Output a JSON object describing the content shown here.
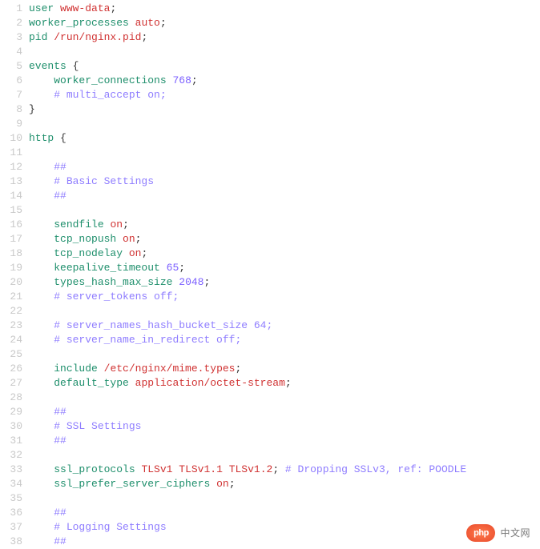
{
  "watermark": {
    "logo": "php",
    "text": "中文网"
  },
  "lines": [
    {
      "n": 1,
      "tokens": [
        [
          "kw",
          "user"
        ],
        [
          "txt",
          " "
        ],
        [
          "val",
          "www-data"
        ],
        [
          "txt",
          ";"
        ]
      ]
    },
    {
      "n": 2,
      "tokens": [
        [
          "kw",
          "worker_processes"
        ],
        [
          "txt",
          " "
        ],
        [
          "val",
          "auto"
        ],
        [
          "txt",
          ";"
        ]
      ]
    },
    {
      "n": 3,
      "tokens": [
        [
          "kw",
          "pid"
        ],
        [
          "txt",
          " "
        ],
        [
          "val",
          "/run/nginx.pid"
        ],
        [
          "txt",
          ";"
        ]
      ]
    },
    {
      "n": 4,
      "tokens": []
    },
    {
      "n": 5,
      "tokens": [
        [
          "kw",
          "events"
        ],
        [
          "txt",
          " "
        ],
        [
          "brace",
          "{"
        ]
      ]
    },
    {
      "n": 6,
      "tokens": [
        [
          "txt",
          "    "
        ],
        [
          "kw",
          "worker_connections"
        ],
        [
          "txt",
          " "
        ],
        [
          "num",
          "768"
        ],
        [
          "txt",
          ";"
        ]
      ]
    },
    {
      "n": 7,
      "tokens": [
        [
          "txt",
          "    "
        ],
        [
          "cmt",
          "# multi_accept on;"
        ]
      ]
    },
    {
      "n": 8,
      "tokens": [
        [
          "brace",
          "}"
        ]
      ]
    },
    {
      "n": 9,
      "tokens": []
    },
    {
      "n": 10,
      "tokens": [
        [
          "kw",
          "http"
        ],
        [
          "txt",
          " "
        ],
        [
          "brace",
          "{"
        ]
      ]
    },
    {
      "n": 11,
      "tokens": []
    },
    {
      "n": 12,
      "tokens": [
        [
          "txt",
          "    "
        ],
        [
          "cmt",
          "##"
        ]
      ]
    },
    {
      "n": 13,
      "tokens": [
        [
          "txt",
          "    "
        ],
        [
          "cmt",
          "# Basic Settings"
        ]
      ]
    },
    {
      "n": 14,
      "tokens": [
        [
          "txt",
          "    "
        ],
        [
          "cmt",
          "##"
        ]
      ]
    },
    {
      "n": 15,
      "tokens": []
    },
    {
      "n": 16,
      "tokens": [
        [
          "txt",
          "    "
        ],
        [
          "kw",
          "sendfile"
        ],
        [
          "txt",
          " "
        ],
        [
          "val",
          "on"
        ],
        [
          "txt",
          ";"
        ]
      ]
    },
    {
      "n": 17,
      "tokens": [
        [
          "txt",
          "    "
        ],
        [
          "kw",
          "tcp_nopush"
        ],
        [
          "txt",
          " "
        ],
        [
          "val",
          "on"
        ],
        [
          "txt",
          ";"
        ]
      ]
    },
    {
      "n": 18,
      "tokens": [
        [
          "txt",
          "    "
        ],
        [
          "kw",
          "tcp_nodelay"
        ],
        [
          "txt",
          " "
        ],
        [
          "val",
          "on"
        ],
        [
          "txt",
          ";"
        ]
      ]
    },
    {
      "n": 19,
      "tokens": [
        [
          "txt",
          "    "
        ],
        [
          "kw",
          "keepalive_timeout"
        ],
        [
          "txt",
          " "
        ],
        [
          "num",
          "65"
        ],
        [
          "txt",
          ";"
        ]
      ]
    },
    {
      "n": 20,
      "tokens": [
        [
          "txt",
          "    "
        ],
        [
          "kw",
          "types_hash_max_size"
        ],
        [
          "txt",
          " "
        ],
        [
          "num",
          "2048"
        ],
        [
          "txt",
          ";"
        ]
      ]
    },
    {
      "n": 21,
      "tokens": [
        [
          "txt",
          "    "
        ],
        [
          "cmt",
          "# server_tokens off;"
        ]
      ]
    },
    {
      "n": 22,
      "tokens": []
    },
    {
      "n": 23,
      "tokens": [
        [
          "txt",
          "    "
        ],
        [
          "cmt",
          "# server_names_hash_bucket_size 64;"
        ]
      ]
    },
    {
      "n": 24,
      "tokens": [
        [
          "txt",
          "    "
        ],
        [
          "cmt",
          "# server_name_in_redirect off;"
        ]
      ]
    },
    {
      "n": 25,
      "tokens": []
    },
    {
      "n": 26,
      "tokens": [
        [
          "txt",
          "    "
        ],
        [
          "kw",
          "include"
        ],
        [
          "txt",
          " "
        ],
        [
          "val",
          "/etc/nginx/mime.types"
        ],
        [
          "txt",
          ";"
        ]
      ]
    },
    {
      "n": 27,
      "tokens": [
        [
          "txt",
          "    "
        ],
        [
          "kw",
          "default_type"
        ],
        [
          "txt",
          " "
        ],
        [
          "val",
          "application/octet-stream"
        ],
        [
          "txt",
          ";"
        ]
      ]
    },
    {
      "n": 28,
      "tokens": []
    },
    {
      "n": 29,
      "tokens": [
        [
          "txt",
          "    "
        ],
        [
          "cmt",
          "##"
        ]
      ]
    },
    {
      "n": 30,
      "tokens": [
        [
          "txt",
          "    "
        ],
        [
          "cmt",
          "# SSL Settings"
        ]
      ]
    },
    {
      "n": 31,
      "tokens": [
        [
          "txt",
          "    "
        ],
        [
          "cmt",
          "##"
        ]
      ]
    },
    {
      "n": 32,
      "tokens": []
    },
    {
      "n": 33,
      "tokens": [
        [
          "txt",
          "    "
        ],
        [
          "kw",
          "ssl_protocols"
        ],
        [
          "txt",
          " "
        ],
        [
          "val",
          "TLSv1"
        ],
        [
          "txt",
          " "
        ],
        [
          "val",
          "TLSv1.1"
        ],
        [
          "txt",
          " "
        ],
        [
          "val",
          "TLSv1.2"
        ],
        [
          "txt",
          "; "
        ],
        [
          "cmt",
          "# Dropping SSLv3, ref: POODLE"
        ]
      ]
    },
    {
      "n": 34,
      "tokens": [
        [
          "txt",
          "    "
        ],
        [
          "kw",
          "ssl_prefer_server_ciphers"
        ],
        [
          "txt",
          " "
        ],
        [
          "val",
          "on"
        ],
        [
          "txt",
          ";"
        ]
      ]
    },
    {
      "n": 35,
      "tokens": []
    },
    {
      "n": 36,
      "tokens": [
        [
          "txt",
          "    "
        ],
        [
          "cmt",
          "##"
        ]
      ]
    },
    {
      "n": 37,
      "tokens": [
        [
          "txt",
          "    "
        ],
        [
          "cmt",
          "# Logging Settings"
        ]
      ]
    },
    {
      "n": 38,
      "tokens": [
        [
          "txt",
          "    "
        ],
        [
          "cmt",
          "##"
        ]
      ]
    }
  ]
}
